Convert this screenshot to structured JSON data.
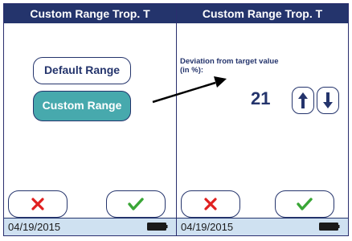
{
  "left_screen": {
    "title": "Custom Range Trop. T",
    "default_range_label": "Default Range",
    "custom_range_label": "Custom Range",
    "footer_date": "04/19/2015"
  },
  "right_screen": {
    "title": "Custom Range Trop. T",
    "deviation_label": "Deviation from target value (in %):",
    "deviation_value": "21",
    "footer_date": "04/19/2015"
  },
  "icons": {
    "cancel": "x-icon",
    "confirm": "checkmark-icon",
    "increase": "arrow-up-icon",
    "decrease": "arrow-down-icon",
    "battery": "battery-icon",
    "pointer": "pointer-arrow-icon"
  },
  "colors": {
    "title_bar": "#24346c",
    "selected_button": "#47a9ad",
    "cancel_icon": "#e02020",
    "confirm_icon": "#3aa637",
    "footer": "#cfe1f1"
  }
}
